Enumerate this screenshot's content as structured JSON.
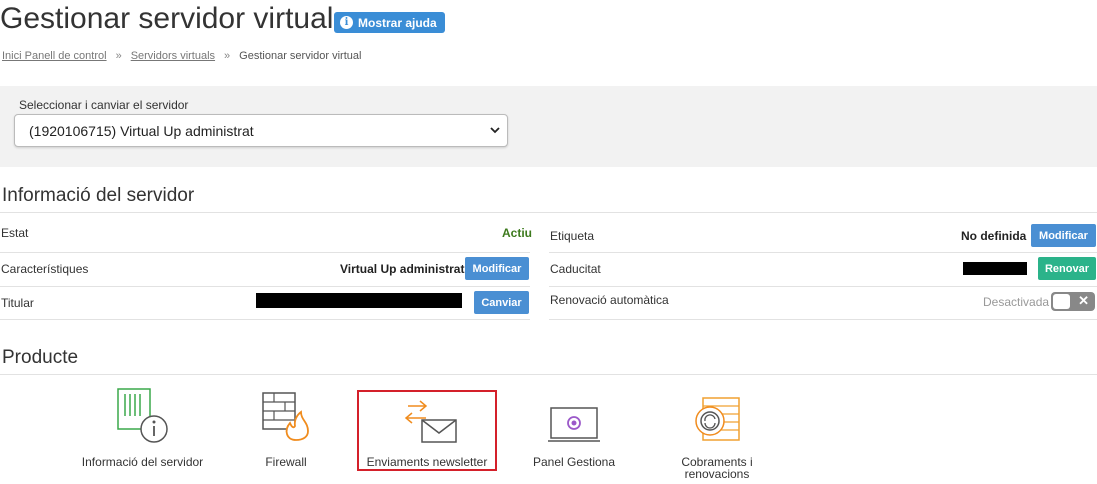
{
  "page": {
    "title": "Gestionar servidor virtual",
    "help_button": "Mostrar ajuda"
  },
  "breadcrumb": {
    "items": [
      "Inici Panell de control",
      "Servidors virtuals"
    ],
    "current": "Gestionar servidor virtual",
    "separator": "»"
  },
  "server_selector": {
    "label": "Seleccionar i canviar el servidor",
    "selected": "(1920106715) Virtual Up administrat"
  },
  "server_info": {
    "heading": "Informació del servidor",
    "estat_label": "Estat",
    "estat_value": "Actiu",
    "caracteristiques_label": "Característiques",
    "caracteristiques_value": "Virtual Up administrat",
    "caracteristiques_button": "Modificar",
    "titular_label": "Titular",
    "titular_button": "Canviar",
    "etiqueta_label": "Etiqueta",
    "etiqueta_value": "No definida",
    "etiqueta_button": "Modificar",
    "caducitat_label": "Caducitat",
    "caducitat_button": "Renovar",
    "renovacio_label": "Renovació automàtica",
    "renovacio_value": "Desactivada"
  },
  "product": {
    "heading": "Producte",
    "items": [
      {
        "label": "Informació del servidor",
        "icon": "server-info-icon"
      },
      {
        "label": "Firewall",
        "icon": "firewall-icon"
      },
      {
        "label": "Enviaments newsletter",
        "icon": "newsletter-icon"
      },
      {
        "label": "Panel Gestiona",
        "icon": "laptop-icon"
      },
      {
        "label": "Cobraments i renovacions",
        "icon": "billing-icon"
      }
    ]
  },
  "colors": {
    "primary_button": "#4a8fd3",
    "renew_button": "#2bb38a",
    "active_status": "#3d7a1d",
    "highlight": "#d4202a",
    "icon_accent": "#f08c1e"
  }
}
